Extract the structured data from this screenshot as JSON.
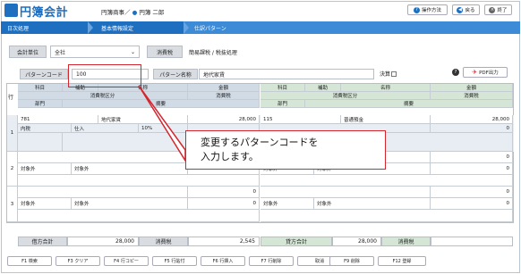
{
  "header": {
    "app_title": "円簿会計",
    "company_label": "円簿商事／",
    "user_label": "円簿 二郎",
    "help_button": "操作方法",
    "back_button": "戻る",
    "exit_button": "終了"
  },
  "nav": {
    "crumbs": [
      "日次処理",
      "基本情報設定",
      "仕訳パターン"
    ]
  },
  "filters": {
    "accounting_unit_label": "会計単位",
    "accounting_unit_value": "全社",
    "tax_label": "消費税",
    "tax_value": "簡易課税 / 税抜処理"
  },
  "pattern": {
    "code_label": "パターンコード",
    "code_value": "100",
    "name_label": "パターン名称",
    "name_value": "地代家賃",
    "settlement_label": "決算",
    "pdf_button": "PDF出力"
  },
  "grid": {
    "row_header": "行",
    "left_headers": {
      "account": "科目",
      "sub": "補助",
      "name": "名称",
      "amount": "金額",
      "tax_class": "消費税区分",
      "tax": "消費税",
      "dept": "部門",
      "memo": "摘要"
    },
    "right_headers": {
      "account": "科目",
      "sub": "補助",
      "name": "名称",
      "amount": "金額",
      "tax_class": "消費税区分",
      "tax": "消費税",
      "dept": "部門",
      "memo": "摘要"
    },
    "rows": [
      {
        "no": "1",
        "l_code": "781",
        "l_name": "地代家賃",
        "l_amount": "28,000",
        "l_tax_class": "内税",
        "l_tax_type": "仕入",
        "l_rate": "10%",
        "l_tax": "",
        "r_code": "115",
        "r_name": "普通預金",
        "r_amount": "28,000",
        "r_tax_class": "",
        "r_tax_type": "",
        "r_tax": "0"
      },
      {
        "no": "2",
        "l_code": "",
        "l_name": "",
        "l_amount": "0",
        "l_tax_class": "対象外",
        "l_tax_type": "対象外",
        "l_rate": "",
        "l_tax": "0",
        "r_code": "",
        "r_name": "",
        "r_amount": "0",
        "r_tax_class": "対象外",
        "r_tax_type": "対象外",
        "r_tax": "0"
      },
      {
        "no": "3",
        "l_code": "",
        "l_name": "",
        "l_amount": "0",
        "l_tax_class": "対象外",
        "l_tax_type": "対象外",
        "l_rate": "",
        "l_tax": "0",
        "r_code": "",
        "r_name": "",
        "r_amount": "0",
        "r_tax_class": "対象外",
        "r_tax_type": "対象外",
        "r_tax": "0"
      }
    ]
  },
  "totals": {
    "debit_label": "借方合計",
    "debit_value": "28,000",
    "debit_tax_label": "消費税",
    "debit_tax_value": "2,545",
    "credit_label": "貸方合計",
    "credit_value": "28,000",
    "credit_tax_label": "消費税",
    "credit_tax_value": ""
  },
  "fkeys": [
    "F1 検索",
    "F3 クリア",
    "F4 行コピー",
    "F5 行貼付",
    "F6 行挿入",
    "F7 行削除",
    "取消",
    "F9 削除",
    "F12 登録"
  ],
  "callout": {
    "line1": "変更するパターンコードを",
    "line2": "入力します。"
  },
  "colors": {
    "accent": "#1e6fc0",
    "callout_border": "#d3262d",
    "debit_header": "#d0dbe6",
    "credit_header": "#d6e6d6"
  }
}
